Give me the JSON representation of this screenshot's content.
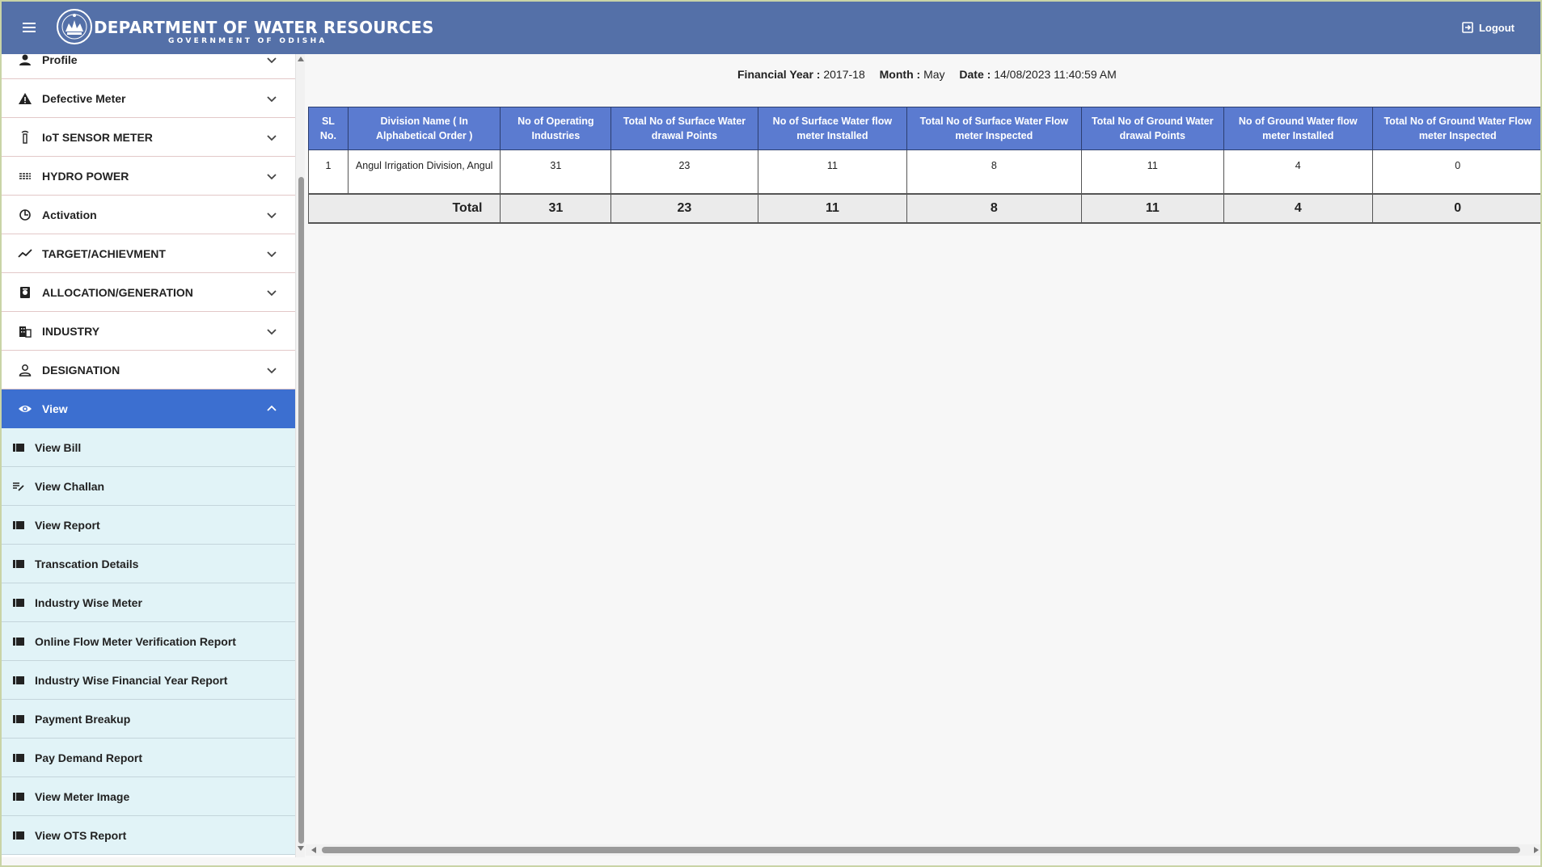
{
  "header": {
    "title": "DEPARTMENT OF WATER RESOURCES",
    "subtitle": "GOVERNMENT OF ODISHA",
    "logout_label": "Logout"
  },
  "sidebar": {
    "items": [
      {
        "label": "Profile",
        "icon": "person-icon"
      },
      {
        "label": "Defective Meter",
        "icon": "warning-icon"
      },
      {
        "label": "IoT SENSOR METER",
        "icon": "sensor-icon"
      },
      {
        "label": "HYDRO POWER",
        "icon": "hydro-icon"
      },
      {
        "label": "Activation",
        "icon": "activation-icon"
      },
      {
        "label": "TARGET/ACHIEVMENT",
        "icon": "trending-icon"
      },
      {
        "label": "ALLOCATION/GENERATION",
        "icon": "allocation-icon"
      },
      {
        "label": "INDUSTRY",
        "icon": "building-icon"
      },
      {
        "label": "DESIGNATION",
        "icon": "person-outline-icon"
      },
      {
        "label": "View",
        "icon": "eye-icon",
        "active": true
      }
    ],
    "sub_items": [
      {
        "label": "View Bill",
        "icon": "list-icon"
      },
      {
        "label": "View Challan",
        "icon": "edit-note-icon"
      },
      {
        "label": "View Report",
        "icon": "list-icon"
      },
      {
        "label": "Transcation Details",
        "icon": "list-icon"
      },
      {
        "label": "Industry Wise Meter",
        "icon": "list-icon"
      },
      {
        "label": "Online Flow Meter Verification Report",
        "icon": "list-icon"
      },
      {
        "label": "Industry Wise Financial Year Report",
        "icon": "list-icon"
      },
      {
        "label": "Payment Breakup",
        "icon": "list-icon"
      },
      {
        "label": "Pay Demand Report",
        "icon": "list-icon"
      },
      {
        "label": "View Meter Image",
        "icon": "list-icon"
      },
      {
        "label": "View OTS Report",
        "icon": "list-icon"
      }
    ]
  },
  "report": {
    "financial_year_label": "Financial Year :",
    "financial_year": "2017-18",
    "month_label": "Month :",
    "month": "May",
    "date_label": "Date :",
    "date": "14/08/2023 11:40:59 AM",
    "columns": [
      "SL No.",
      "Division Name ( In Alphabetical Order )",
      "No of Operating Industries",
      "Total No of Surface Water drawal Points",
      "No of Surface Water flow meter Installed",
      "Total No of Surface Water Flow meter Inspected",
      "Total No of Ground Water drawal Points",
      "No of Ground Water flow meter Installed",
      "Total No of Ground Water Flow meter Inspected"
    ],
    "rows": [
      [
        "1",
        "Angul Irrigation Division, Angul",
        "31",
        "23",
        "11",
        "8",
        "11",
        "4",
        "0"
      ]
    ],
    "total": {
      "label": "Total",
      "values": [
        "31",
        "23",
        "11",
        "8",
        "11",
        "4",
        "0"
      ]
    }
  },
  "colors": {
    "header_bg": "#5470a8",
    "active_menu": "#3c6fd0",
    "table_header": "#5b7bd0",
    "submenu_bg": "#e1f3f7"
  }
}
